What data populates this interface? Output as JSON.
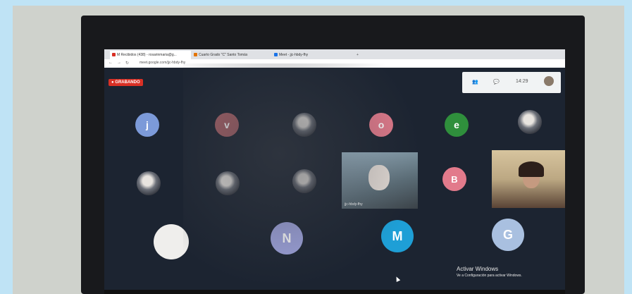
{
  "browser": {
    "tabs": [
      {
        "label": "M  Recibidos (438) - rosarinmaria@g...",
        "icon_color": "#d93025"
      },
      {
        "label": "Cuarto Grado \"C\" Santo Tomás",
        "icon_color": "#e37400"
      },
      {
        "label": "Meet - jjc-hbdy-fhy",
        "icon_color": "#1a73e8"
      }
    ],
    "address": "meet.google.com/jjc-hbdy-fhy"
  },
  "meeting": {
    "recording_label": "GRABANDO",
    "time": "14:29",
    "participants": [
      {
        "letter": "j",
        "color": "#7c9ad9"
      },
      {
        "letter": "v",
        "color": "#a66066"
      },
      {
        "letter": "",
        "color": "photo"
      },
      {
        "letter": "o",
        "color": "#e27a8b"
      },
      {
        "letter": "e",
        "color": "#2f8f3c"
      },
      {
        "letter": "",
        "color": "photo"
      },
      {
        "letter": "",
        "color": "photo"
      },
      {
        "letter": "",
        "color": "photo"
      },
      {
        "letter": "",
        "color": "photo"
      },
      {
        "letter": "B",
        "color": "#e27a8b"
      },
      {
        "letter": "",
        "color": "photo"
      },
      {
        "letter": "N",
        "color": "#9ea3dc"
      },
      {
        "letter": "M",
        "color": "#1e9fd6"
      },
      {
        "letter": "G",
        "color": "#a9c0e0"
      }
    ],
    "video_tile_name": "jjc-hbdy-fhy",
    "windows_watermark": {
      "title": "Activar Windows",
      "subtitle": "Ve a Configuración para activar Windows."
    }
  }
}
